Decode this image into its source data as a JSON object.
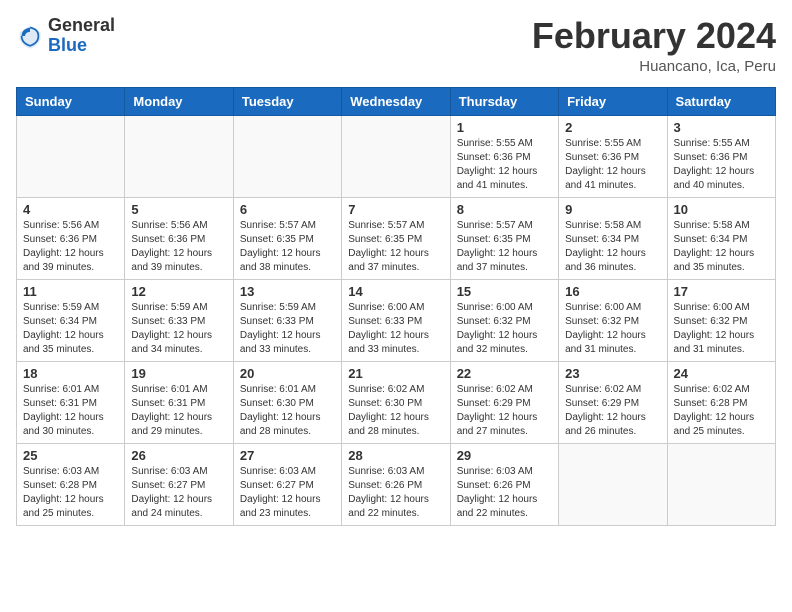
{
  "header": {
    "logo_general": "General",
    "logo_blue": "Blue",
    "month_title": "February 2024",
    "location": "Huancano, Ica, Peru"
  },
  "weekdays": [
    "Sunday",
    "Monday",
    "Tuesday",
    "Wednesday",
    "Thursday",
    "Friday",
    "Saturday"
  ],
  "weeks": [
    [
      {
        "day": "",
        "info": ""
      },
      {
        "day": "",
        "info": ""
      },
      {
        "day": "",
        "info": ""
      },
      {
        "day": "",
        "info": ""
      },
      {
        "day": "1",
        "info": "Sunrise: 5:55 AM\nSunset: 6:36 PM\nDaylight: 12 hours\nand 41 minutes."
      },
      {
        "day": "2",
        "info": "Sunrise: 5:55 AM\nSunset: 6:36 PM\nDaylight: 12 hours\nand 41 minutes."
      },
      {
        "day": "3",
        "info": "Sunrise: 5:55 AM\nSunset: 6:36 PM\nDaylight: 12 hours\nand 40 minutes."
      }
    ],
    [
      {
        "day": "4",
        "info": "Sunrise: 5:56 AM\nSunset: 6:36 PM\nDaylight: 12 hours\nand 39 minutes."
      },
      {
        "day": "5",
        "info": "Sunrise: 5:56 AM\nSunset: 6:36 PM\nDaylight: 12 hours\nand 39 minutes."
      },
      {
        "day": "6",
        "info": "Sunrise: 5:57 AM\nSunset: 6:35 PM\nDaylight: 12 hours\nand 38 minutes."
      },
      {
        "day": "7",
        "info": "Sunrise: 5:57 AM\nSunset: 6:35 PM\nDaylight: 12 hours\nand 37 minutes."
      },
      {
        "day": "8",
        "info": "Sunrise: 5:57 AM\nSunset: 6:35 PM\nDaylight: 12 hours\nand 37 minutes."
      },
      {
        "day": "9",
        "info": "Sunrise: 5:58 AM\nSunset: 6:34 PM\nDaylight: 12 hours\nand 36 minutes."
      },
      {
        "day": "10",
        "info": "Sunrise: 5:58 AM\nSunset: 6:34 PM\nDaylight: 12 hours\nand 35 minutes."
      }
    ],
    [
      {
        "day": "11",
        "info": "Sunrise: 5:59 AM\nSunset: 6:34 PM\nDaylight: 12 hours\nand 35 minutes."
      },
      {
        "day": "12",
        "info": "Sunrise: 5:59 AM\nSunset: 6:33 PM\nDaylight: 12 hours\nand 34 minutes."
      },
      {
        "day": "13",
        "info": "Sunrise: 5:59 AM\nSunset: 6:33 PM\nDaylight: 12 hours\nand 33 minutes."
      },
      {
        "day": "14",
        "info": "Sunrise: 6:00 AM\nSunset: 6:33 PM\nDaylight: 12 hours\nand 33 minutes."
      },
      {
        "day": "15",
        "info": "Sunrise: 6:00 AM\nSunset: 6:32 PM\nDaylight: 12 hours\nand 32 minutes."
      },
      {
        "day": "16",
        "info": "Sunrise: 6:00 AM\nSunset: 6:32 PM\nDaylight: 12 hours\nand 31 minutes."
      },
      {
        "day": "17",
        "info": "Sunrise: 6:00 AM\nSunset: 6:32 PM\nDaylight: 12 hours\nand 31 minutes."
      }
    ],
    [
      {
        "day": "18",
        "info": "Sunrise: 6:01 AM\nSunset: 6:31 PM\nDaylight: 12 hours\nand 30 minutes."
      },
      {
        "day": "19",
        "info": "Sunrise: 6:01 AM\nSunset: 6:31 PM\nDaylight: 12 hours\nand 29 minutes."
      },
      {
        "day": "20",
        "info": "Sunrise: 6:01 AM\nSunset: 6:30 PM\nDaylight: 12 hours\nand 28 minutes."
      },
      {
        "day": "21",
        "info": "Sunrise: 6:02 AM\nSunset: 6:30 PM\nDaylight: 12 hours\nand 28 minutes."
      },
      {
        "day": "22",
        "info": "Sunrise: 6:02 AM\nSunset: 6:29 PM\nDaylight: 12 hours\nand 27 minutes."
      },
      {
        "day": "23",
        "info": "Sunrise: 6:02 AM\nSunset: 6:29 PM\nDaylight: 12 hours\nand 26 minutes."
      },
      {
        "day": "24",
        "info": "Sunrise: 6:02 AM\nSunset: 6:28 PM\nDaylight: 12 hours\nand 25 minutes."
      }
    ],
    [
      {
        "day": "25",
        "info": "Sunrise: 6:03 AM\nSunset: 6:28 PM\nDaylight: 12 hours\nand 25 minutes."
      },
      {
        "day": "26",
        "info": "Sunrise: 6:03 AM\nSunset: 6:27 PM\nDaylight: 12 hours\nand 24 minutes."
      },
      {
        "day": "27",
        "info": "Sunrise: 6:03 AM\nSunset: 6:27 PM\nDaylight: 12 hours\nand 23 minutes."
      },
      {
        "day": "28",
        "info": "Sunrise: 6:03 AM\nSunset: 6:26 PM\nDaylight: 12 hours\nand 22 minutes."
      },
      {
        "day": "29",
        "info": "Sunrise: 6:03 AM\nSunset: 6:26 PM\nDaylight: 12 hours\nand 22 minutes."
      },
      {
        "day": "",
        "info": ""
      },
      {
        "day": "",
        "info": ""
      }
    ]
  ]
}
